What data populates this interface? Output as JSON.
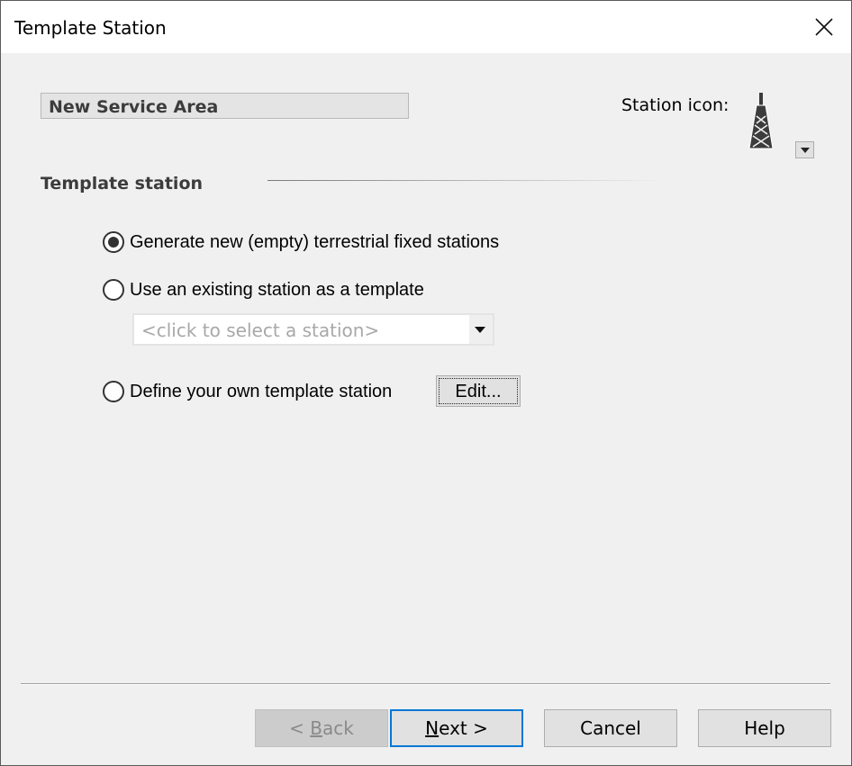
{
  "window": {
    "title": "Template Station",
    "close_icon": "close-icon"
  },
  "header": {
    "service_area_name": "New Service Area",
    "station_icon_label": "Station icon:",
    "station_icon": "radio-tower-icon"
  },
  "section": {
    "title": "Template station"
  },
  "options": [
    {
      "label": "Generate new (empty) terrestrial fixed stations",
      "checked": true
    },
    {
      "label": "Use an existing station as a template",
      "checked": false
    },
    {
      "label": "Define your own template station",
      "checked": false
    }
  ],
  "station_select": {
    "placeholder": "<click to select a station>"
  },
  "edit_button": {
    "label": "Edit..."
  },
  "footer": {
    "back": {
      "prefix": "< ",
      "mnemonic": "B",
      "rest": "ack",
      "enabled": false
    },
    "next": {
      "mnemonic": "N",
      "rest": "ext >",
      "default": true
    },
    "cancel": "Cancel",
    "help": "Help"
  },
  "colors": {
    "accent": "#0078d7",
    "background": "#f0f0f0",
    "titlebar": "#ffffff"
  }
}
